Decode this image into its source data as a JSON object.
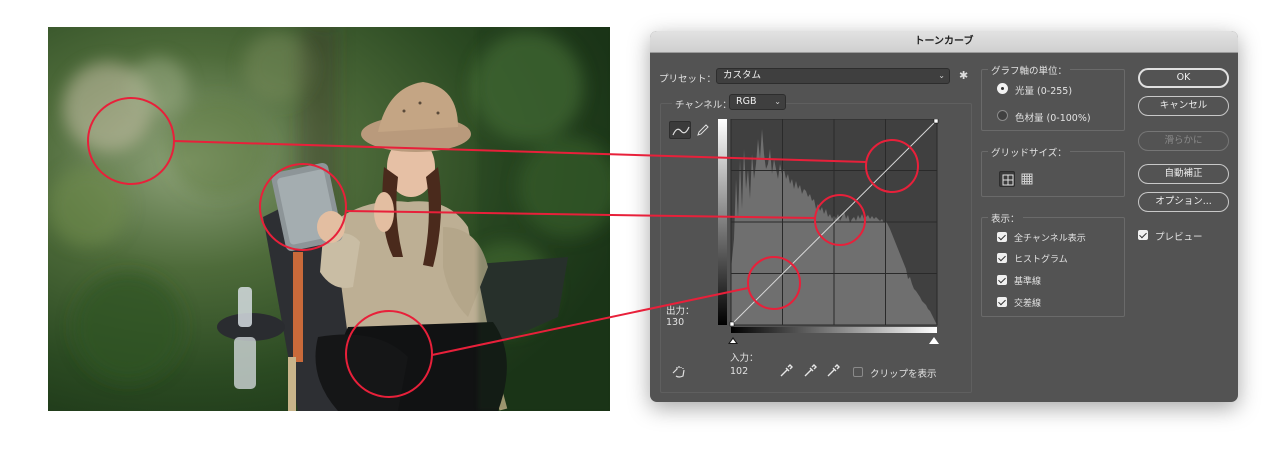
{
  "dialog": {
    "title": "トーンカーブ",
    "preset_label": "プリセット：",
    "preset_value": "カスタム",
    "channel_label": "チャンネル：",
    "channel_value": "RGB",
    "output_label": "出力：",
    "output_value": "130",
    "input_label": "入力：",
    "input_value": "102",
    "clip_label": "クリップを表示",
    "graph_unit_group": "グラフ軸の単位：",
    "unit_light": "光量 (0-255)",
    "unit_pigment": "色材量 (0-100%)",
    "grid_size_group": "グリッドサイズ：",
    "display_group": "表示：",
    "show_all_channels": "全チャンネル表示",
    "show_histogram": "ヒストグラム",
    "show_baseline": "基準線",
    "show_intersection": "交差線",
    "buttons": {
      "ok": "OK",
      "cancel": "キャンセル",
      "smooth": "滑らかに",
      "auto": "自動補正",
      "options": "オプション..."
    },
    "preview_label": "プレビュー"
  },
  "icons": {
    "curve_tool": "curve-point-icon",
    "pencil_tool": "pencil-icon",
    "gear": "gear-icon",
    "hand": "on-image-adjust-icon",
    "eyedroppers": [
      "black-point-eyedropper-icon",
      "gray-point-eyedropper-icon",
      "white-point-eyedropper-icon"
    ]
  },
  "colors": {
    "annotation": "#e8203a",
    "dialog_bg": "#535353"
  }
}
